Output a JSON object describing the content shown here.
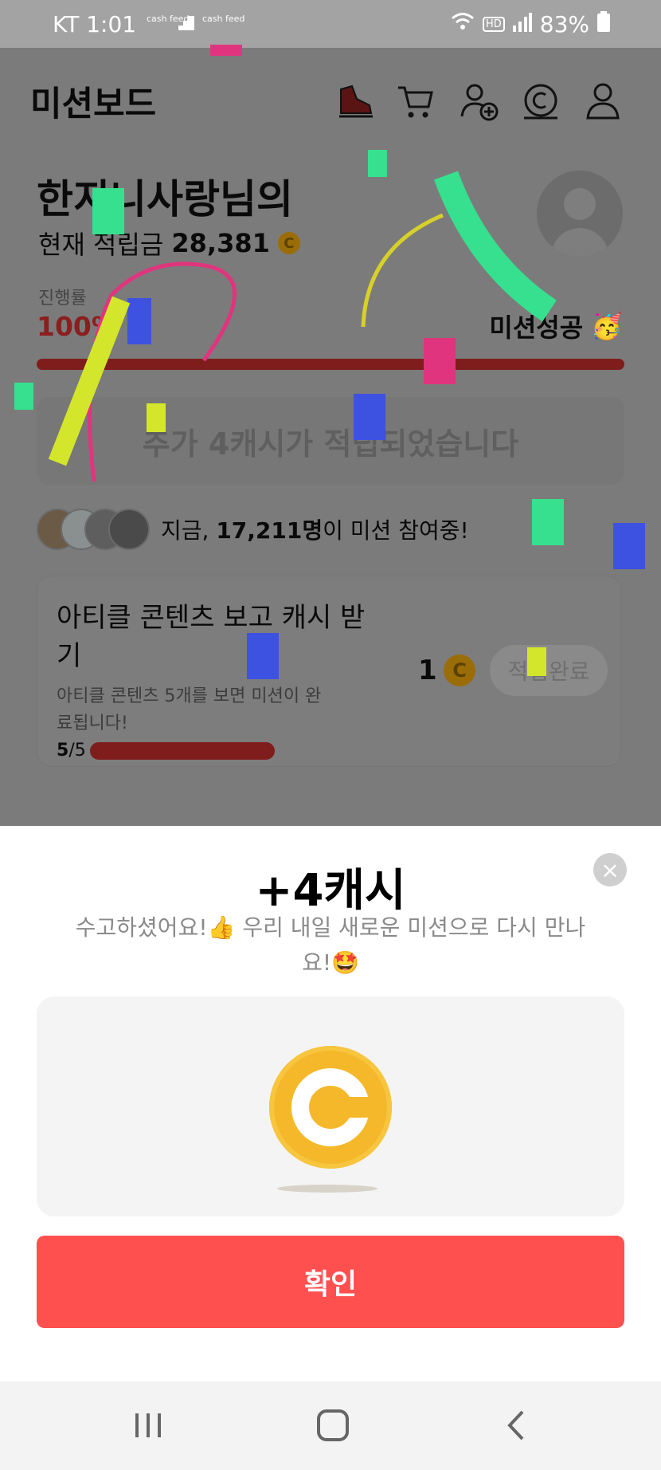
{
  "status_bar": {
    "time": "KT 1:01",
    "cashfeed_badge": "cash feed",
    "battery": "83%",
    "network_badge": "HD"
  },
  "header": {
    "title": "미션보드",
    "icons": [
      "shoe-icon",
      "cart-icon",
      "add-friend-icon",
      "cash-icon",
      "profile-icon"
    ]
  },
  "profile": {
    "greeting": "한지니사랑님의",
    "balance_label": "현재 적립금",
    "balance_value": "28,381",
    "coin_symbol": "C"
  },
  "progress": {
    "label": "진행률",
    "percent_text": "100%",
    "percent": 100,
    "success_text": "미션성공",
    "success_emoji": "🥳"
  },
  "bonus_message": "추가 4캐시가 적립되었습니다",
  "participants": {
    "prefix": "지금, ",
    "count": "17,211명",
    "suffix": "이 미션 참여중!"
  },
  "mission": {
    "title": "아티클 콘텐츠 보고 캐시 받기",
    "description": "아티클 콘텐츠 5개를 보면 미션이 완료됩니다!",
    "progress_current": "5",
    "progress_total": "/5",
    "reward": "1",
    "reward_coin": "C",
    "status_button": "적립완료"
  },
  "sheet": {
    "title": "+4캐시",
    "subtitle": "수고하셨어요!👍 우리 내일 새로운 미션으로 다시 만나요!🤩",
    "confirm_label": "확인",
    "close_symbol": "×"
  },
  "colors": {
    "accent_red": "#ff5050",
    "coin_gold": "#f5b82a",
    "progress_dark_red": "#7f1d1d",
    "overlay_gray": "#7b7b7b"
  }
}
